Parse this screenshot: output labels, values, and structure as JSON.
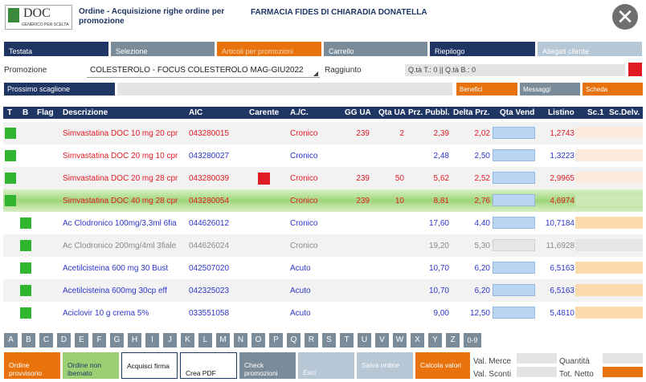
{
  "header": {
    "logo_text": "DOC",
    "logo_sub": "GENERICO PER SCELTA",
    "title": "Ordine - Acquisizione righe ordine per promozione",
    "pharmacy": "FARMACIA FIDES DI CHIARADIA DONATELLA",
    "close": "✕"
  },
  "tabs": [
    {
      "label": "Testata",
      "color": "#1f3564"
    },
    {
      "label": "Selezione",
      "color": "#7a8c9a"
    },
    {
      "label": "Articoli per promozioni",
      "color": "#e8720c"
    },
    {
      "label": "Carrello",
      "color": "#7a8c9a"
    },
    {
      "label": "Riepilogo",
      "color": "#1f3564"
    },
    {
      "label": "Allegati cliente",
      "color": "#b6c7d6"
    }
  ],
  "promo": {
    "label": "Promozione",
    "value": "COLESTEROLO - FOCUS COLESTEROLO MAG-GIU2022",
    "reached_label": "Raggiunto",
    "reached_value": "Q.tà T.: 0 || Q.tà B.: 0",
    "flag_color": "#e01b24"
  },
  "next_tier": {
    "label": "Prossimo scaglione"
  },
  "side_buttons": [
    {
      "label": "Benefici"
    },
    {
      "label": "Messaggi"
    },
    {
      "label": "Scheda"
    }
  ],
  "table": {
    "headers": {
      "t": "T",
      "b": "B",
      "flag": "Flag",
      "desc": "Descrizione",
      "aic": "AIC",
      "carente": "Carente",
      "ac": "A./C.",
      "gg": "GG UA",
      "qta": "Qta UA",
      "prz": "Prz. Pubbl.",
      "delta": "Delta Prz.",
      "qtav": "Qta Vend",
      "listino": "Listino",
      "sc1": "Sc.1",
      "scdelv": "Sc.Delv."
    },
    "rows": [
      {
        "desc": "Simvastatina DOC 10 mg 20 cpr",
        "aic": "043280015",
        "ac": "Cronico",
        "gg": "239",
        "qta": "2",
        "prz": "2,39",
        "delta": "2,02",
        "listino": "1,2743"
      },
      {
        "desc": "Simvastatina DOC 20 mg 10 cpr",
        "aic": "043280027",
        "ac": "Cronico",
        "gg": "",
        "qta": "",
        "prz": "2,48",
        "delta": "2,50",
        "listino": "1,3223"
      },
      {
        "desc": "Simvastatina DOC 20 mg 28 cpr",
        "aic": "043280039",
        "ac": "Cronico",
        "gg": "239",
        "qta": "50",
        "prz": "5,62",
        "delta": "2,52",
        "listino": "2,9965"
      },
      {
        "desc": "Simvastatina DOC 40 mg 28 cpr",
        "aic": "043280054",
        "ac": "Cronico",
        "gg": "239",
        "qta": "10",
        "prz": "8,81",
        "delta": "2,76",
        "listino": "4,6974"
      },
      {
        "desc": "Ac Clodronico 100mg/3,3ml 6fia",
        "aic": "044626012",
        "ac": "Cronico",
        "gg": "",
        "qta": "",
        "prz": "17,60",
        "delta": "4,40",
        "listino": "10,7184"
      },
      {
        "desc": "Ac Clodronico 200mg/4ml 3fiale",
        "aic": "044626024",
        "ac": "Cronico",
        "gg": "",
        "qta": "",
        "prz": "19,20",
        "delta": "5,30",
        "listino": "11,6928"
      },
      {
        "desc": "Acetilcisteina 600 mg  30 Bust",
        "aic": "042507020",
        "ac": "Acuto",
        "gg": "",
        "qta": "",
        "prz": "10,70",
        "delta": "6,20",
        "listino": "6,5163"
      },
      {
        "desc": "Acetilcisteina 600mg 30cp eff",
        "aic": "042325023",
        "ac": "Acuto",
        "gg": "",
        "qta": "",
        "prz": "10,70",
        "delta": "6,20",
        "listino": "6,5163"
      },
      {
        "desc": "Aciclovir 10 g crema 5%",
        "aic": "033551058",
        "ac": "Acuto",
        "gg": "",
        "qta": "",
        "prz": "9,00",
        "delta": "12,50",
        "listino": "5,4810"
      }
    ]
  },
  "letters": [
    "A",
    "B",
    "C",
    "D",
    "E",
    "F",
    "G",
    "H",
    "I",
    "J",
    "K",
    "L",
    "M",
    "N",
    "O",
    "P",
    "Q",
    "R",
    "S",
    "T",
    "U",
    "V",
    "W",
    "X",
    "Y",
    "Z",
    "0-9"
  ],
  "bottom": {
    "buttons": [
      {
        "label": "Ordine provvisorio"
      },
      {
        "label": "Ordine non ibernato"
      },
      {
        "label": "Acquisci firma"
      },
      {
        "label": "Crea PDF"
      },
      {
        "label": "Check promozioni"
      },
      {
        "label": "Esci"
      },
      {
        "label": "Salva ordine"
      },
      {
        "label": "Calcola valori"
      }
    ],
    "val_merce": "Val. Merce",
    "val_sconti": "Val. Sconti",
    "quantita": "Quantità",
    "tot_netto": "Tot. Netto"
  }
}
